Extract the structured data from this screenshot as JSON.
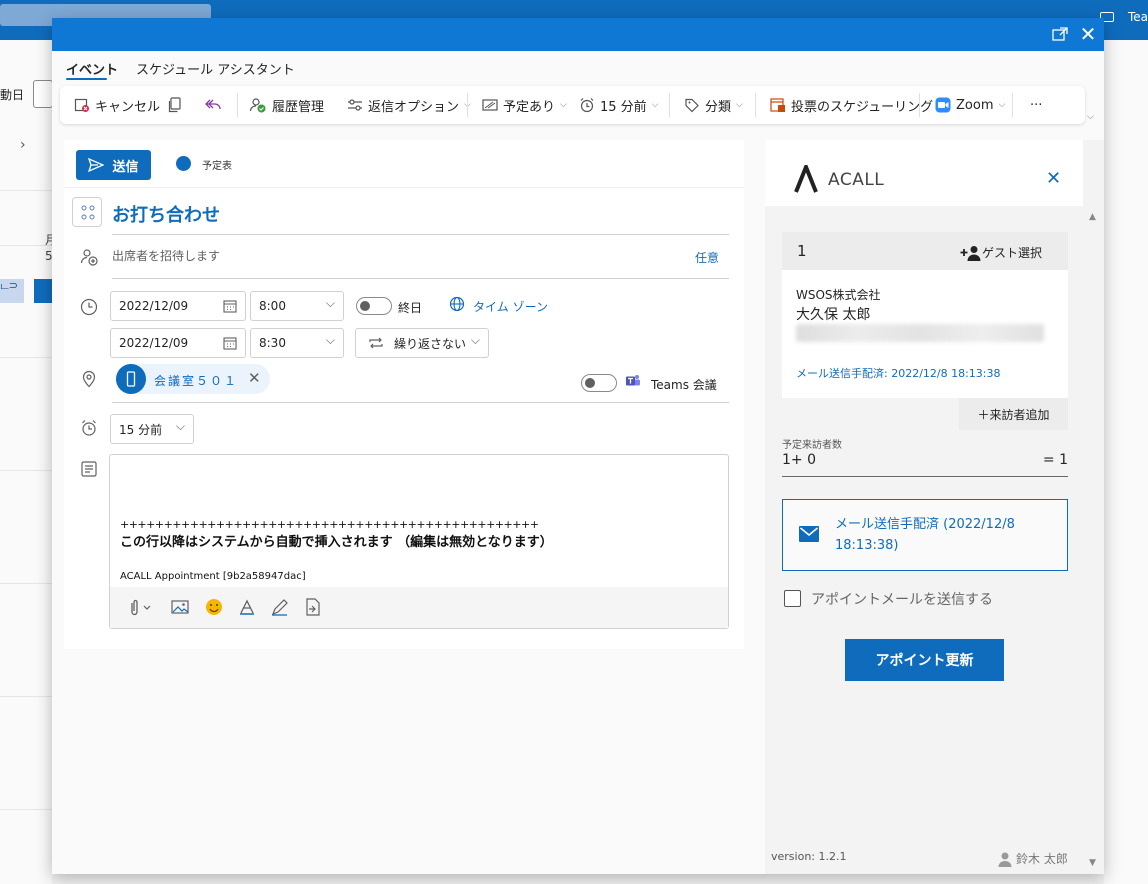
{
  "background": {
    "top_right_text": "Tea",
    "left_label": "動日",
    "date_day": "月",
    "date_num": "5",
    "event_chip": "ட⊃",
    "event_chip2": "石"
  },
  "tabs": [
    {
      "label": "イベント",
      "active": true
    },
    {
      "label": "スケジュール アシスタント",
      "active": false
    }
  ],
  "ribbon": {
    "cancel": "キャンセル",
    "history": "履歴管理",
    "reply_options": "返信オプション",
    "show_as": "予定あり",
    "reminder": "15 分前",
    "categorize": "分類",
    "scheduling_poll": "投票のスケジューリング",
    "zoom": "Zoom",
    "more": "···"
  },
  "compose": {
    "send": "送信",
    "calendar": "予定表",
    "title": "お打ち合わせ",
    "attendee_placeholder": "出席者を招待します",
    "optional": "任意",
    "start_date": "2022/12/09",
    "start_time": "8:00",
    "all_day": "終日",
    "time_zone": "タイム ゾーン",
    "end_date": "2022/12/09",
    "end_time": "8:30",
    "repeat": "繰り返さない",
    "room": "会議室５０１",
    "teams": "Teams 会議",
    "reminder": "15 分前",
    "body_plus": "++++++++++++++++++++++++++++++++++++++++++++++++",
    "body_note": "この行以降はシステムから自動で挿入されます （編集は無効となります）",
    "body_acall": "ACALL Appointment [9b2a58947dac]"
  },
  "acall": {
    "brand": "ACALL",
    "guest_count": "1",
    "guest_select": "ゲスト選択",
    "company": "WSOS株式会社",
    "person": "大久保 太郎",
    "mail_sent": "メール送信手配済: 2022/12/8 18:13:38",
    "add_visitor": "＋来訪者追加",
    "expected_label": "予定来訪者数",
    "expected_left": "1+ 0",
    "expected_right": "= 1",
    "mail_box_text": "メール送信手配済 (2022/12/8 18:13:38)",
    "send_mail_label": "アポイントメールを送信する",
    "send_mail_checked": false,
    "update_button": "アポイント更新",
    "version": "version: 1.2.1",
    "user": "鈴木 太郎"
  },
  "colors": {
    "accent": "#0f6cbd",
    "title_bar": "#0f78d4"
  }
}
